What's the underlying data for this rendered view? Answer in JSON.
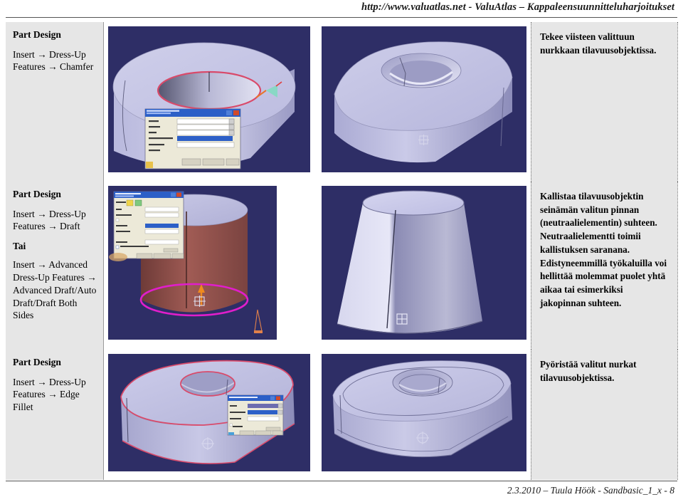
{
  "header": {
    "text": "http://www.valuatlas.net - ValuAtlas – Kappaleensuunnitteluharjoitukset"
  },
  "footer": {
    "text": "2.3.2010 – Tuula Höök - Sandbasic_1_x - 8"
  },
  "rows": [
    {
      "command": {
        "app": "Part Design",
        "path1": "Insert → Dress-Up Features → Chamfer",
        "alt_label": "",
        "path2": ""
      },
      "figures": [
        {
          "name": "chamfer-selection-view",
          "caption": "CATIA chamfer selection on hole edge with Chamfer Definition dialog",
          "dialog_title": "Chamfer Definition",
          "dialog_fields": [
            "Mode",
            "Length 1",
            "Angle",
            "Object(s) to chamfer",
            "Propagation"
          ],
          "dialog_buttons": [
            "OK",
            "Cancel",
            "Preview"
          ],
          "highlight_color": "#d94a6a",
          "bg_color": "#2e2e66"
        },
        {
          "name": "chamfer-result-view",
          "caption": "Resulting oval solid with chamfered hole",
          "bg_color": "#2e2e66"
        }
      ],
      "description": "Tekee viisteen valittuun nurkkaan tilavuusobjektissa."
    },
    {
      "command": {
        "app": "Part Design",
        "path1": "Insert → Dress-Up Features → Draft",
        "alt_label": "Tai",
        "path2": "Insert → Advanced Dress-Up Features → Advanced Draft/Auto Draft/Draft Both Sides"
      },
      "figures": [
        {
          "name": "draft-selection-view",
          "caption": "CATIA draft selection on cylinder wall with Draft Definition dialog",
          "dialog_title": "Draft Definition",
          "dialog_fields": [
            "Draft Type",
            "Angle",
            "Neutral Element Selection",
            "Propagation",
            "Pulling Direction",
            "Selection"
          ],
          "dialog_buttons": [
            "OK",
            "Cancel",
            "Preview"
          ],
          "highlight_color": "#e01ecb",
          "face_color": "#8a4a45",
          "bg_color": "#2e2e66"
        },
        {
          "name": "draft-result-view",
          "caption": "Resulting tapered (drafted) cone",
          "bg_color": "#2e2e66"
        }
      ],
      "description": "Kallistaa tilavuusobjektin seinämän valitun pinnan (neutraalielementin) suhteen. Neutraalielementti toimii kallistuksen saranana. Edistyneemmillä työkaluilla voi hellittää molemmat puolet yhtä aikaa tai esimerkiksi jakopinnan suhteen."
    },
    {
      "command": {
        "app": "Part Design",
        "path1": "Insert → Dress-Up Features → Edge Fillet",
        "alt_label": "",
        "path2": ""
      },
      "figures": [
        {
          "name": "fillet-selection-view",
          "caption": "CATIA edge fillet selection with Edge Fillet Definition dialog",
          "dialog_title": "Edge Fillet Definition",
          "dialog_fields": [
            "Radius",
            "Object(s) to fillet",
            "Propagation"
          ],
          "dialog_buttons": [
            "OK",
            "Cancel",
            "Preview"
          ],
          "highlight_color": "#d94a6a",
          "bg_color": "#2e2e66"
        },
        {
          "name": "fillet-result-view",
          "caption": "Resulting oval solid with rounded edges",
          "bg_color": "#2e2e66"
        }
      ],
      "description": "Pyöristää valitut nurkat tilavuusobjektissa."
    }
  ],
  "colors": {
    "cell_gray": "#e6e6e6",
    "viewport_navy": "#2e2e66",
    "solid_lilac": "#c3c3e4",
    "dialog_blue": "#2c5fc7"
  }
}
